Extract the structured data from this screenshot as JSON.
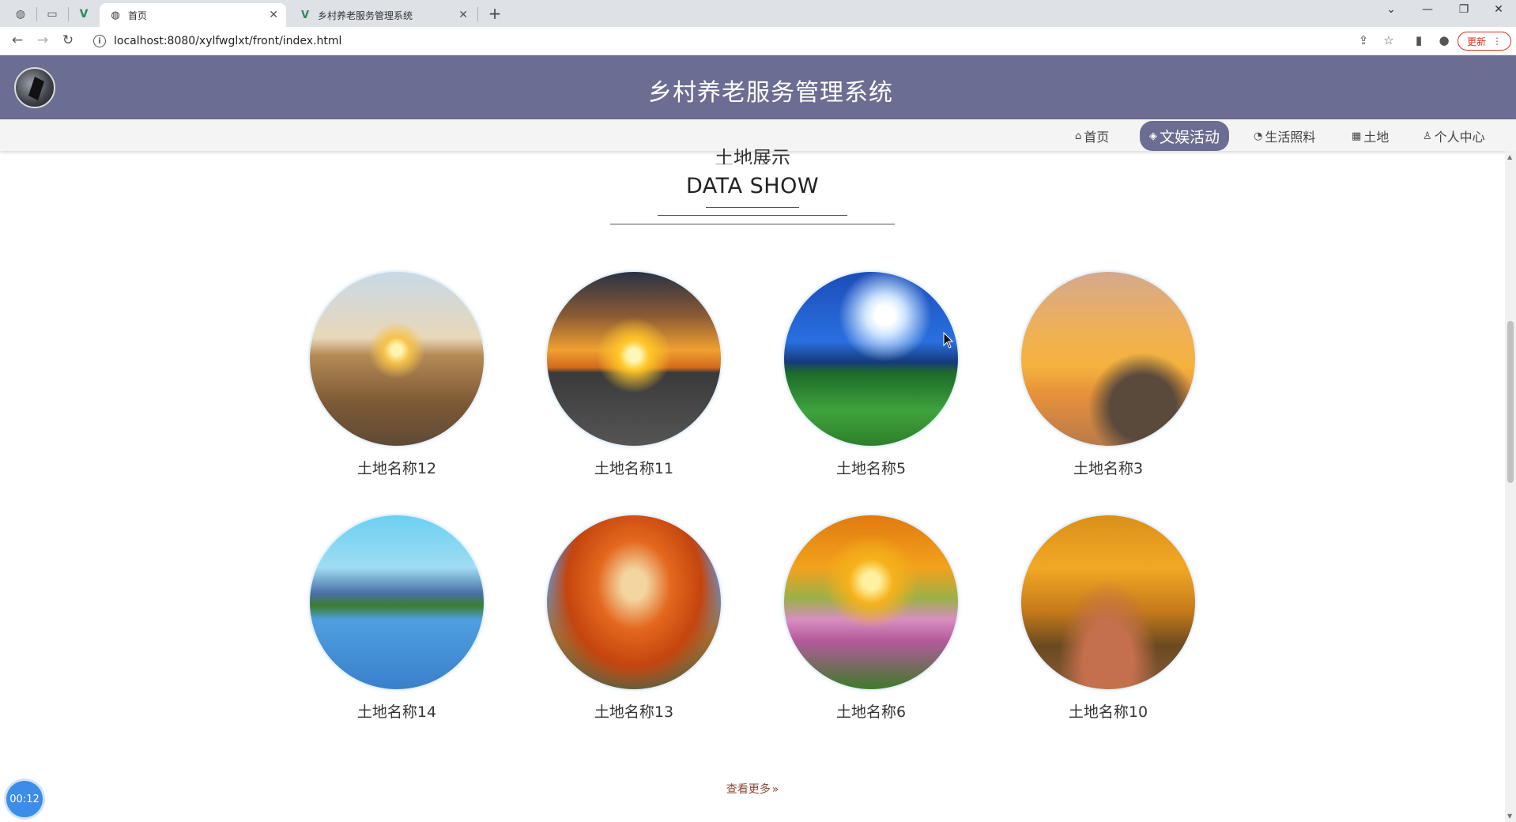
{
  "browser": {
    "tabs": [
      {
        "title": "首页",
        "active": true
      },
      {
        "title": "乡村养老服务管理系统",
        "active": false
      }
    ],
    "url": "localhost:8080/xylfwglxt/front/index.html",
    "update_label": "更新"
  },
  "site": {
    "title": "乡村养老服务管理系统",
    "nav": [
      {
        "label": "首页",
        "icon": "home-icon",
        "active": false
      },
      {
        "label": "文娱活动",
        "icon": "layers-icon",
        "active": true
      },
      {
        "label": "生活照料",
        "icon": "palette-icon",
        "active": false
      },
      {
        "label": "土地",
        "icon": "grid-icon",
        "active": false
      },
      {
        "label": "个人中心",
        "icon": "user-icon",
        "active": false
      }
    ]
  },
  "section": {
    "title_cn": "土地展示",
    "title_en": "DATA SHOW",
    "items": [
      {
        "name": "土地名称12"
      },
      {
        "name": "土地名称11"
      },
      {
        "name": "土地名称5"
      },
      {
        "name": "土地名称3"
      },
      {
        "name": "土地名称14"
      },
      {
        "name": "土地名称13"
      },
      {
        "name": "土地名称6"
      },
      {
        "name": "土地名称10"
      }
    ],
    "more_label": "查看更多"
  },
  "timer": "00:12",
  "colors": {
    "header_bg": "#6b6d92",
    "nav_active": "#6b6d92",
    "more_link": "#8b4a3a",
    "timer_bg": "#3b8de8"
  }
}
